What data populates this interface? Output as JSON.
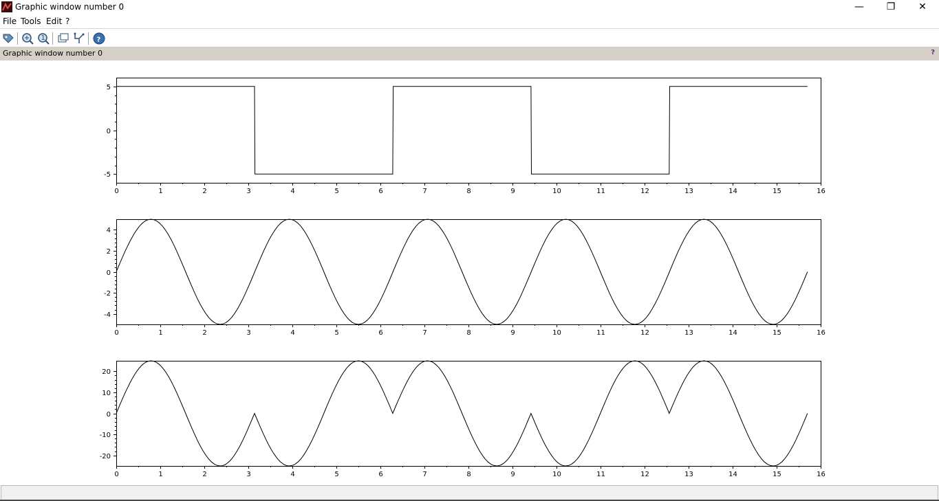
{
  "window": {
    "title": "Graphic window number 0",
    "controls": {
      "minimize": "—",
      "maximize": "❐",
      "close": "✕"
    }
  },
  "menu": [
    "File",
    "Tools",
    "Edit",
    "?"
  ],
  "toolbar": {
    "icons": [
      "datatip-icon",
      "zoom-icon",
      "unzoom-icon",
      "rotate-icon",
      "editor-icon",
      "help-icon"
    ]
  },
  "infobar": {
    "text": "Graphic window number 0",
    "help": "?"
  },
  "statusbar": {
    "text": ""
  },
  "chart_data": [
    {
      "type": "line",
      "xlim": [
        0,
        16
      ],
      "ylim": [
        -6,
        6
      ],
      "xticks": [
        0,
        1,
        2,
        3,
        4,
        5,
        6,
        7,
        8,
        9,
        10,
        11,
        12,
        13,
        14,
        15,
        16
      ],
      "yticks": [
        -5,
        0,
        5
      ],
      "grid": false,
      "series": [
        {
          "x": [
            0,
            3.14,
            3.15,
            6.28,
            6.29,
            9.42,
            9.43,
            12.56,
            12.57,
            15.7
          ],
          "y": [
            5,
            5,
            -5,
            -5,
            5,
            5,
            -5,
            -5,
            5,
            5
          ]
        }
      ]
    },
    {
      "type": "line",
      "xlim": [
        0,
        16
      ],
      "ylim": [
        -5,
        5
      ],
      "xticks": [
        0,
        1,
        2,
        3,
        4,
        5,
        6,
        7,
        8,
        9,
        10,
        11,
        12,
        13,
        14,
        15,
        16
      ],
      "yticks": [
        -4,
        -2,
        0,
        2,
        4
      ],
      "grid": false,
      "series": [
        {
          "x": [
            0,
            0.79,
            2.36,
            3.93,
            5.5,
            7.07,
            8.64,
            10.21,
            11.78,
            13.35,
            14.92,
            15.7
          ],
          "y": [
            0,
            5,
            -5,
            5,
            -5,
            5,
            -5,
            5,
            -5,
            5,
            -5,
            0
          ]
        }
      ]
    },
    {
      "type": "line",
      "xlim": [
        0,
        16
      ],
      "ylim": [
        -25,
        25
      ],
      "xticks": [
        0,
        1,
        2,
        3,
        4,
        5,
        6,
        7,
        8,
        9,
        10,
        11,
        12,
        13,
        14,
        15,
        16
      ],
      "yticks": [
        -20,
        -10,
        0,
        10,
        20
      ],
      "grid": false,
      "series": [
        {
          "x": [
            0,
            0.79,
            2.36,
            3.14,
            3.93,
            5.5,
            6.28,
            7.07,
            8.64,
            9.42,
            10.21,
            11.78,
            12.56,
            13.35,
            14.92,
            15.7
          ],
          "y": [
            0,
            25,
            -25,
            0,
            -25,
            25,
            0,
            25,
            -25,
            0,
            -25,
            25,
            0,
            25,
            -25,
            0
          ]
        }
      ]
    }
  ]
}
